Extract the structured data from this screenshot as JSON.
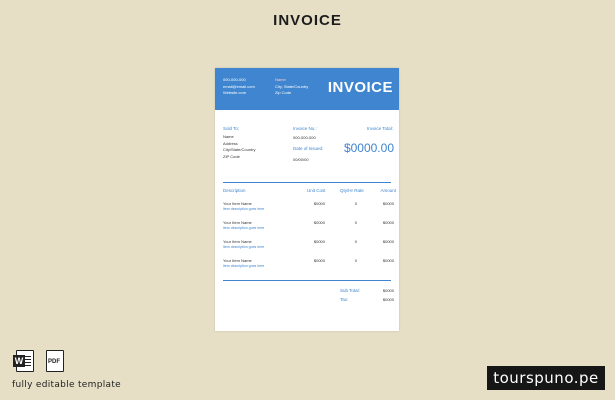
{
  "page_title": "INVOICE",
  "header": {
    "contact": [
      "000-000-000",
      "email@email.com",
      "Website.com"
    ],
    "company": [
      "Name",
      "City, State/Country",
      "Zip Code"
    ],
    "title": "INVOICE"
  },
  "billing": {
    "sold_to_label": "Sold To:",
    "sold_to_lines": [
      "Name",
      "Address",
      "City/State/Country",
      "ZIP Code"
    ],
    "invoice_no_label": "Invoice No.:",
    "invoice_no": "000-000-000",
    "date_label": "Date of Issued:",
    "date": "00/00/00",
    "total_label": "Invoice Total:",
    "total": "$0000.00"
  },
  "table": {
    "headers": [
      "Description",
      "Unit Cost",
      "Qty/Hr Rate",
      "Amount"
    ],
    "rows": [
      {
        "name": "Your Item Name",
        "desc": "Item description goes here",
        "cost": "$0000",
        "qty": "0",
        "amount": "$0000"
      },
      {
        "name": "Your Item Name",
        "desc": "Item description goes here",
        "cost": "$0000",
        "qty": "0",
        "amount": "$0000"
      },
      {
        "name": "Your Item Name",
        "desc": "Item description goes here",
        "cost": "$0000",
        "qty": "0",
        "amount": "$0000"
      },
      {
        "name": "Your Item Name",
        "desc": "Item description goes here",
        "cost": "$0000",
        "qty": "0",
        "amount": "$0000"
      }
    ]
  },
  "totals": {
    "subtotal_label": "Sub Total:",
    "subtotal": "$0000",
    "tax_label": "Tax:",
    "tax": "$0000"
  },
  "icons": {
    "word_letter": "W",
    "pdf_letter": "PDF"
  },
  "caption": "fully editable template",
  "brand": "tourspuno.pe"
}
